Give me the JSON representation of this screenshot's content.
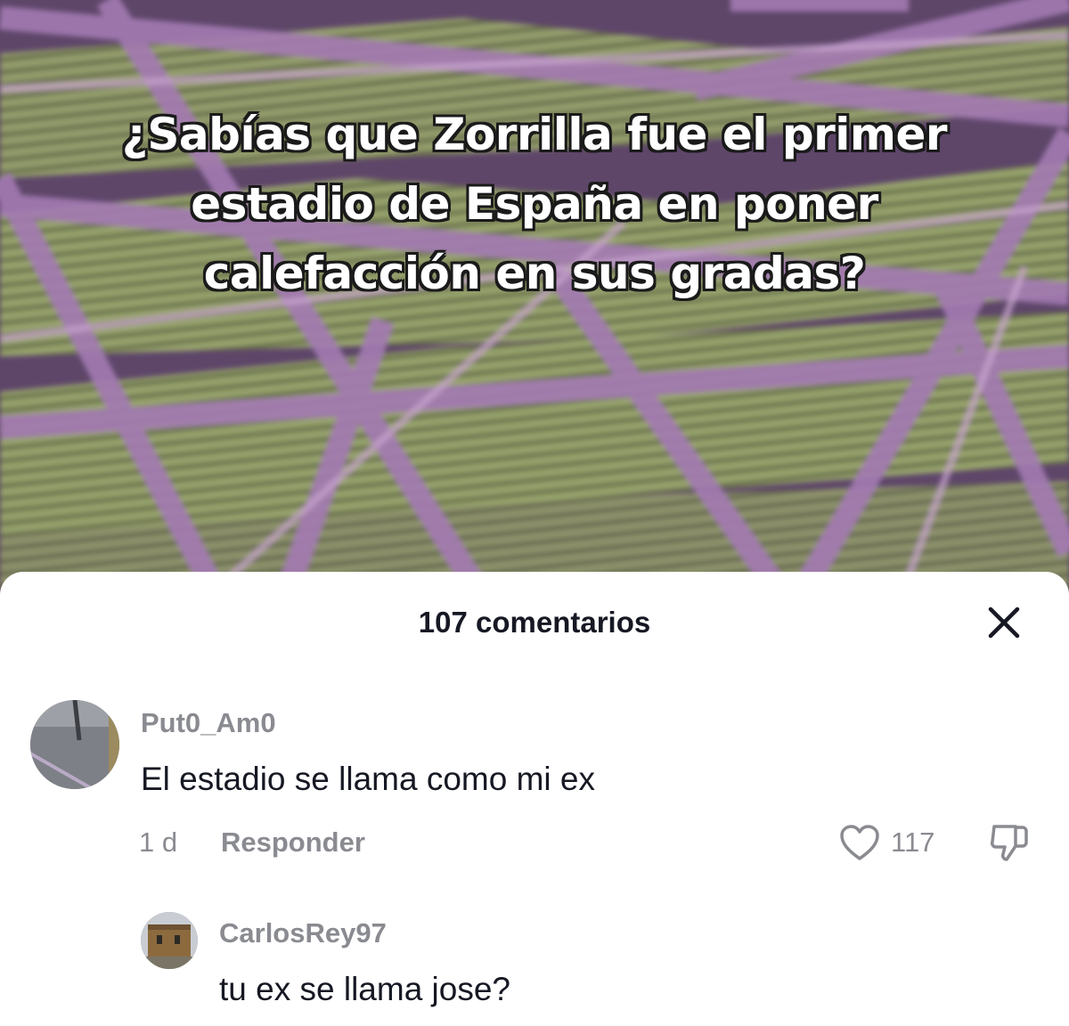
{
  "video": {
    "caption_lines": [
      "¿Sabías que Zorrilla fue el primer",
      "estadio de España en poner",
      "calefacción en sus gradas?"
    ]
  },
  "comments_sheet": {
    "title": "107 comentarios",
    "close_icon": "close-icon",
    "comments": [
      {
        "username": "Put0_Am0",
        "text": "El estadio se llama como mi ex",
        "age": "1 d",
        "reply_label": "Responder",
        "likes": "117",
        "like_icon": "heart-icon",
        "dislike_icon": "thumbs-down-icon"
      }
    ],
    "replies": [
      {
        "username": "CarlosRey97",
        "text": "tu ex se llama jose?"
      }
    ]
  },
  "colors": {
    "text_primary": "#161823",
    "text_secondary": "#8a8b91",
    "sheet_bg": "#ffffff"
  }
}
